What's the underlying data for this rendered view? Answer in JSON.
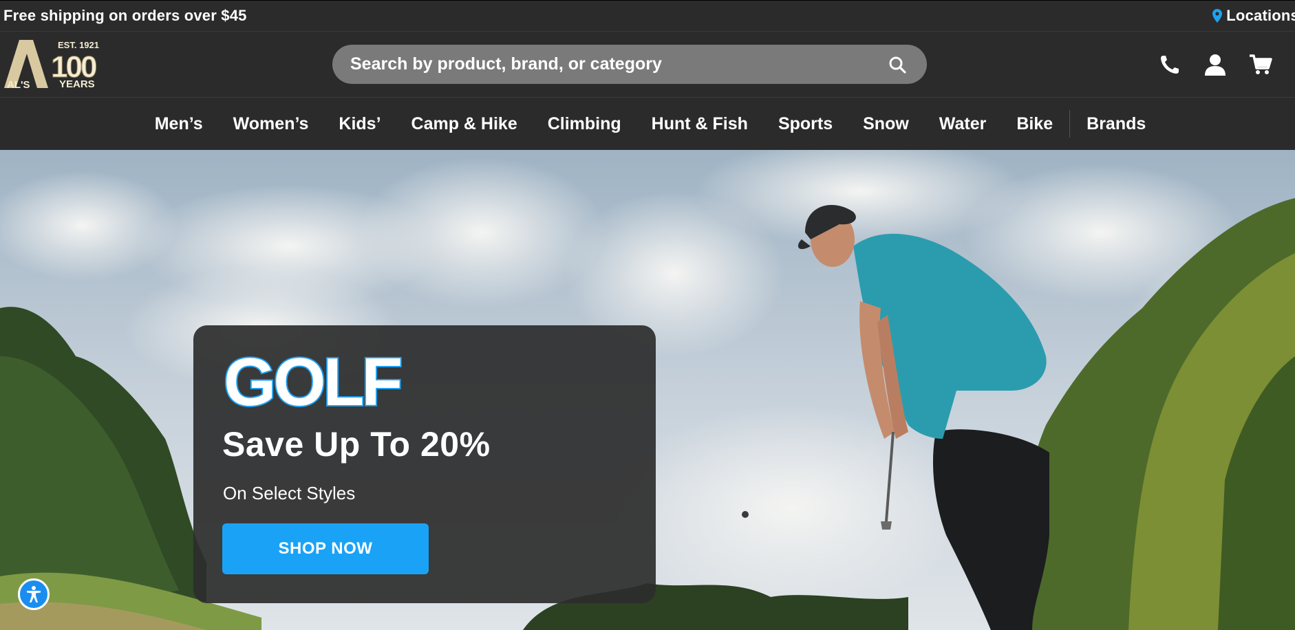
{
  "promo_strip": {
    "message": "Free shipping on orders over $45",
    "locations_label": "Locations"
  },
  "logo": {
    "letter": "A",
    "brand": "AL'S",
    "est": "EST. 1921",
    "years_number": "100",
    "years_word": "YEARS"
  },
  "search": {
    "placeholder": "Search by product, brand, or category"
  },
  "nav": {
    "items": [
      "Men’s",
      "Women’s",
      "Kids’",
      "Camp & Hike",
      "Climbing",
      "Hunt & Fish",
      "Sports",
      "Snow",
      "Water",
      "Bike"
    ],
    "brands_label": "Brands"
  },
  "hero": {
    "sport_word": "GOLF",
    "headline": "Save Up To 20%",
    "subtext": "On Select Styles",
    "cta_label": "SHOP NOW"
  },
  "icons": {
    "pin": "map-pin-icon",
    "search": "search-icon",
    "phone": "phone-icon",
    "account": "user-icon",
    "cart": "cart-icon",
    "accessibility": "accessibility-icon"
  },
  "colors": {
    "header_bg": "#2b2b2b",
    "accent": "#1aa3f6",
    "search_bg": "#7a7a7a",
    "logo_gold": "#d8c9a0"
  }
}
